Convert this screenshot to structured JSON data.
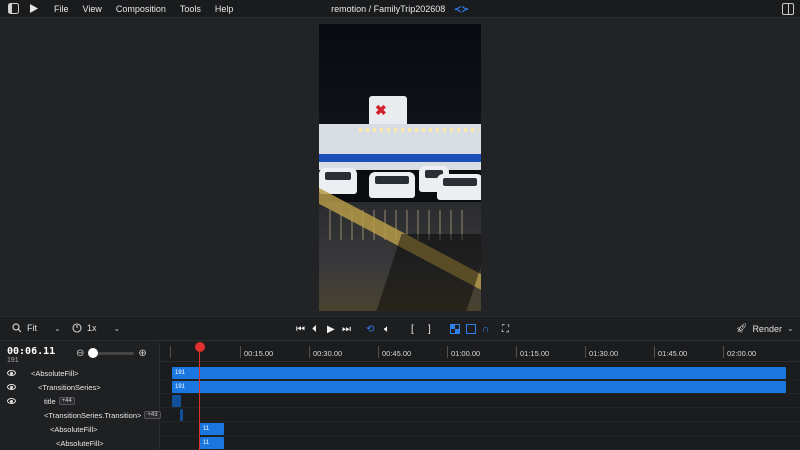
{
  "menubar": {
    "items": [
      "File",
      "View",
      "Composition",
      "Tools",
      "Help"
    ],
    "title": "remotion / FamilyTrip202608"
  },
  "controls": {
    "fit_label": "Fit",
    "speed_label": "1x",
    "render_label": "Render"
  },
  "timeline": {
    "timecode": "00:06.11",
    "frame": "191",
    "ruler": [
      "00:15.00",
      "00:30.00",
      "00:45.00",
      "01:00.00",
      "01:15.00",
      "01:30.00",
      "01:45.00",
      "02:00.00"
    ],
    "layers": [
      {
        "name": "<AbsoluteFill>",
        "visible": true,
        "badge": ""
      },
      {
        "name": "<TransitionSeries>",
        "visible": true,
        "badge": ""
      },
      {
        "name": "title",
        "visible": true,
        "badge": "+44"
      },
      {
        "name": "<TransitionSeries.Transition>",
        "visible": false,
        "badge": "+43"
      },
      {
        "name": "<AbsoluteFill>",
        "visible": false,
        "badge": ""
      },
      {
        "name": "<AbsoluteFill>",
        "visible": false,
        "badge": ""
      }
    ],
    "bars": [
      {
        "label": "191"
      },
      {
        "label": "191"
      },
      {
        "label": ""
      },
      {
        "label": ""
      },
      {
        "label": "11"
      },
      {
        "label": "11"
      }
    ]
  },
  "colors": {
    "accent": "#1b77e0",
    "playhead": "#e0312f"
  }
}
